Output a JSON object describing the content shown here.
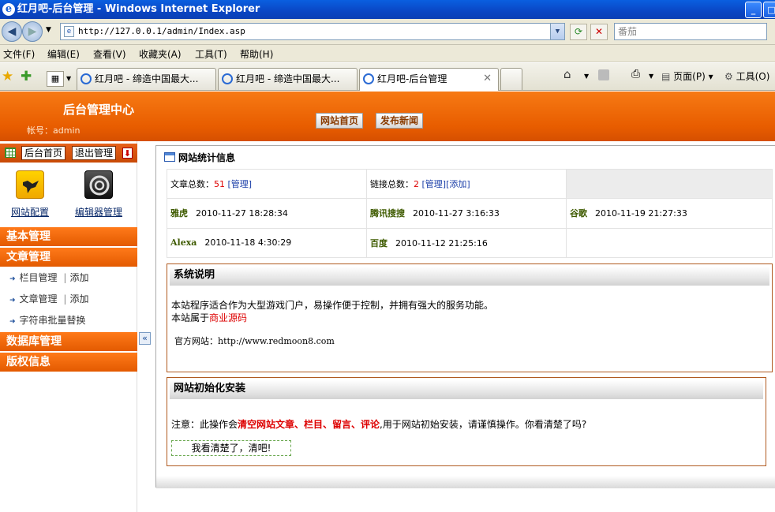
{
  "window": {
    "title": "红月吧-后台管理 - Windows Internet Explorer"
  },
  "address": {
    "url": "http://127.0.0.1/admin/Index.asp",
    "search_placeholder": "番茄"
  },
  "menu": [
    "文件(F)",
    "编辑(E)",
    "查看(V)",
    "收藏夹(A)",
    "工具(T)",
    "帮助(H)"
  ],
  "tabs": [
    {
      "label": "红月吧 - 缔造中国最大..."
    },
    {
      "label": "红月吧 - 缔造中国最大..."
    },
    {
      "label": "红月吧-后台管理"
    }
  ],
  "toolbar": {
    "page": "页面(P)",
    "tools": "工具(O)"
  },
  "header": {
    "title": "后台管理中心",
    "account": "帐号：admin",
    "btn_home": "网站首页",
    "btn_news": "发布新闻"
  },
  "sidebar": {
    "top_home": "后台首页",
    "top_logout": "退出管理",
    "cfg_site": "网站配置",
    "cfg_editor": "编辑器管理",
    "sections": {
      "basic": "基本管理",
      "article": "文章管理",
      "db": "数据库管理",
      "copyright": "版权信息"
    },
    "items": [
      {
        "name": "栏目管理",
        "sep": "|",
        "add": "添加"
      },
      {
        "name": "文章管理",
        "sep": "|",
        "add": "添加"
      },
      {
        "name": "字符串批量替换"
      }
    ],
    "collapse": "«"
  },
  "stats": {
    "title": "网站统计信息",
    "articles_label": "文章总数：",
    "articles_count": "51",
    "articles_manage": "[管理]",
    "links_label": "链接总数：",
    "links_count": "2",
    "links_manage": "[管理]",
    "links_add": "[添加]",
    "spiders": [
      {
        "name": "雅虎",
        "time": "2010-11-27 18:28:34"
      },
      {
        "name": "腾讯搜搜",
        "time": "2010-11-27 3:16:33"
      },
      {
        "name": "谷歌",
        "time": "2010-11-19 21:27:33"
      },
      {
        "name": "Alexa",
        "time": "2010-11-18 4:30:29"
      },
      {
        "name": "百度",
        "time": "2010-11-12 21:25:16"
      }
    ]
  },
  "system": {
    "title": "系统说明",
    "line1": "本站程序适合作为大型游戏门户，易操作便于控制，并拥有强大的服务功能。",
    "line2_prefix": "本站属于",
    "line2_red": "商业源码",
    "site_label": "官方网站：",
    "site_url": "http://www.redmoon8.com"
  },
  "init": {
    "title": "网站初始化安装",
    "note_prefix": "注意：此操作会",
    "note_red": "清空网站文章、栏目、留言、评论",
    "note_suffix": ",用于网站初始安装，请谨慎操作。你看清楚了吗?",
    "confirm": "我看清楚了，清吧!"
  }
}
